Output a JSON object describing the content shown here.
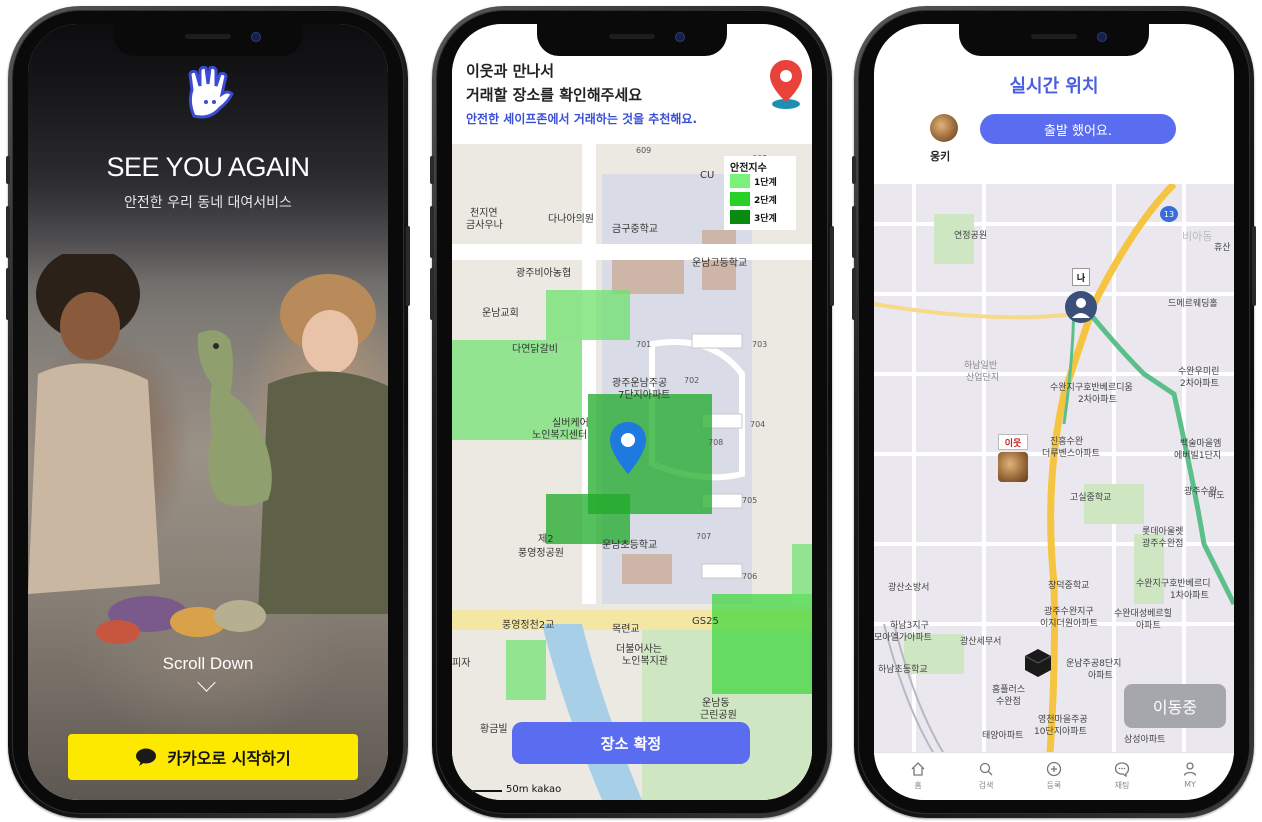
{
  "screen1": {
    "title": "SEE YOU AGAIN",
    "subtitle": "안전한 우리 동네 대여서비스",
    "scroll_label": "Scroll Down",
    "kakao_button_label": "카카오로 시작하기",
    "accent_color": "#fde800"
  },
  "screen2": {
    "header_line1": "이웃과 만나서",
    "header_line2": "거래할 장소를 확인해주세요",
    "header_line3": "안전한 세이프존에서 거래하는 것을 추천해요.",
    "legend": {
      "title": "안전지수",
      "levels": [
        {
          "label": "1단계",
          "color": "#7af27a"
        },
        {
          "label": "2단계",
          "color": "#27d127"
        },
        {
          "label": "3단계",
          "color": "#0b8a12"
        }
      ]
    },
    "map_labels": {
      "cu": "CU",
      "cheonjiyeon": "천지연",
      "sauna": "금사우나",
      "danaa": "다나아의원",
      "geumgu_ms": "금구중학교",
      "unnam_hs": "운남고등학교",
      "gwangju_nh": "광주비아농협",
      "unnam_church": "운남교회",
      "dayeon": "다연닭갈비",
      "gwangju_apt": "광주운남주공",
      "apt_7": "7단지아파트",
      "silver_care": "실버케어",
      "welfare": "노인복지센터",
      "je2": "제2",
      "pungyeong_park": "풍영정공원",
      "unnam_es": "운남초등학교",
      "bridge": "풍영정천2교",
      "gs25": "GS25",
      "mokryeon": "목련교",
      "deobuleo": "더불어사는",
      "senior": "노인복지관",
      "unnamdong": "운남동",
      "neighborhood_park": "근린공원",
      "hwanggeum": "황금빌",
      "ja": "피자",
      "b609": "609",
      "b608": "608",
      "b701": "701",
      "b702": "702",
      "b703": "703",
      "b704": "704",
      "b705": "705",
      "b706": "706",
      "b707": "707",
      "b708": "708"
    },
    "confirm_button_label": "장소 확정",
    "scale_label": "50m",
    "attribution": "kakao"
  },
  "screen3": {
    "title": "실시간 위치",
    "user_name": "웅키",
    "status_text": "출발 했어요.",
    "me_label": "나",
    "neighbor_label": "이웃",
    "moving_button_label": "이동중",
    "route_badge": "13",
    "map_labels": {
      "park_top": "연정공원",
      "bia": "비아동",
      "hyusan": "휴산",
      "wedding": "드메르웨딩홀",
      "hanam_ind": "하남일반",
      "industrial": "산업단지",
      "suwan_umi": "수완우미린",
      "apt_2": "2차아파트",
      "suwan_hobanil": "수완지구호반베르디움",
      "apt_2b": "2차아파트",
      "jinheung": "진흥수완",
      "deoruben": "더루벤스아파트",
      "baeksul": "백술마을엠",
      "ebelri": "에버빌1단지",
      "gosil_es": "고실중학교",
      "gwangju_suwan": "광주수완",
      "lotte": "롯데아울렛",
      "suwanjum": "광주수완점",
      "gwangsan_fire": "광산소방서",
      "changduk": "창덕중학교",
      "hanam3": "하남3지구",
      "moa": "모아엘가아파트",
      "gwangsan_tax": "광산세무서",
      "suwan_ewha": "광주수완지구",
      "ewha": "이지더원아파트",
      "suwan_daesung": "수완대성베르힐",
      "apt_b": "아파트",
      "hanam_es": "하남초등학교",
      "homeplus": "홈플러스",
      "sugwan": "수완점",
      "unnam8": "운남주공8단지",
      "apt_c": "아파트",
      "yeongcheon": "영천마을주공",
      "yeongcheon10": "10단지아파트",
      "taeyang": "태양아파트",
      "samsung": "삼성아파트",
      "suwan_hoban1": "수완지구호반베르디",
      "apt_1": "1차아파트",
      "gwangju_suwan_r": "광주수완",
      "mado": "마도"
    },
    "tabs": [
      {
        "label": "홈",
        "icon": "home-icon"
      },
      {
        "label": "검색",
        "icon": "search-icon"
      },
      {
        "label": "등록",
        "icon": "plus-circle-icon"
      },
      {
        "label": "채팅",
        "icon": "chat-icon"
      },
      {
        "label": "MY",
        "icon": "person-icon"
      }
    ],
    "accent_color": "#5a6cf0"
  }
}
